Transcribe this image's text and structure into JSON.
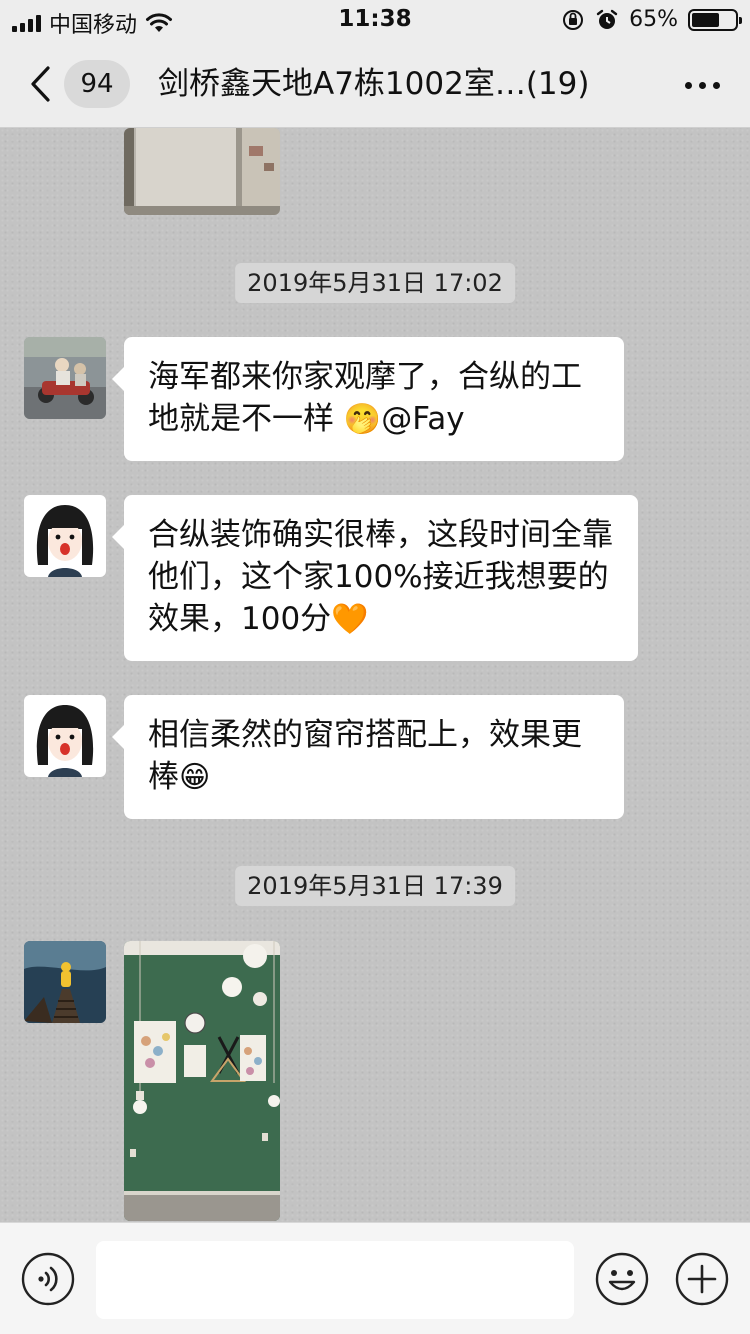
{
  "status_bar": {
    "carrier": "中国移动",
    "time": "11:38",
    "battery_text": "65%",
    "battery_level": 0.65,
    "icons": [
      "signal-icon",
      "wifi-icon",
      "orientation-lock-icon",
      "alarm-icon",
      "battery-icon"
    ]
  },
  "nav": {
    "unread_count": "94",
    "title": "剑桥鑫天地A7栋1002室…(19)"
  },
  "messages": {
    "timestamp_1": "2019年5月31日 17:02",
    "msg_1_text": "海军都来你家观摩了，合纵的工地就是不一样",
    "msg_1_emoji": "🤭",
    "msg_1_mention": "@Fay",
    "msg_2_text": "合纵装饰确实很棒，这段时间全靠他们，这个家100%接近我想要的效果，100分",
    "msg_2_emoji": "🧡",
    "msg_3_text": "相信柔然的窗帘搭配上，效果更棒",
    "msg_3_emoji": "😁",
    "timestamp_2": "2019年5月31日 17:39"
  },
  "input_bar": {
    "placeholder": "",
    "icons": [
      "voice-icon",
      "emoji-icon",
      "plus-icon"
    ]
  },
  "colors": {
    "nav_background": "#ededed",
    "chat_background": "#c3c3c3",
    "bubble_white": "#ffffff",
    "timestamp_bg": "#d6d6d6",
    "wall_green": "#3d6b4f"
  }
}
